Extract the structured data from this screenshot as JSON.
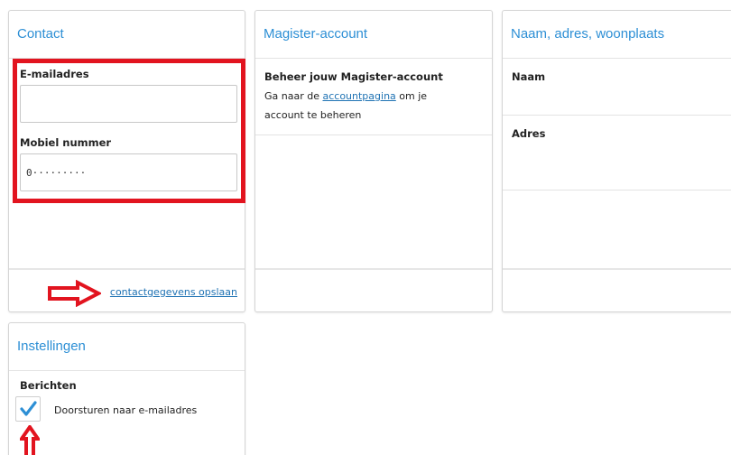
{
  "contact": {
    "title": "Contact",
    "email_label": "E-mailadres",
    "email_value": "",
    "mobile_label": "Mobiel nummer",
    "mobile_value": "0·········",
    "save_link": "contactgegevens opslaan"
  },
  "magister": {
    "title": "Magister-account",
    "heading": "Beheer jouw Magister-account",
    "text_before": "Ga naar de ",
    "link": "accountpagina",
    "text_after": " om je",
    "text_line2": "account te beheren"
  },
  "naw": {
    "title": "Naam, adres, woonplaats",
    "name_label": "Naam",
    "address_label": "Adres"
  },
  "settings": {
    "title": "Instellingen",
    "section_label": "Berichten",
    "forward_label": "Doorsturen naar e-mailadres",
    "forward_checked": true
  },
  "colors": {
    "accent": "#2d8fd5",
    "annotation_red": "#e2141f",
    "link": "#2073b4"
  }
}
